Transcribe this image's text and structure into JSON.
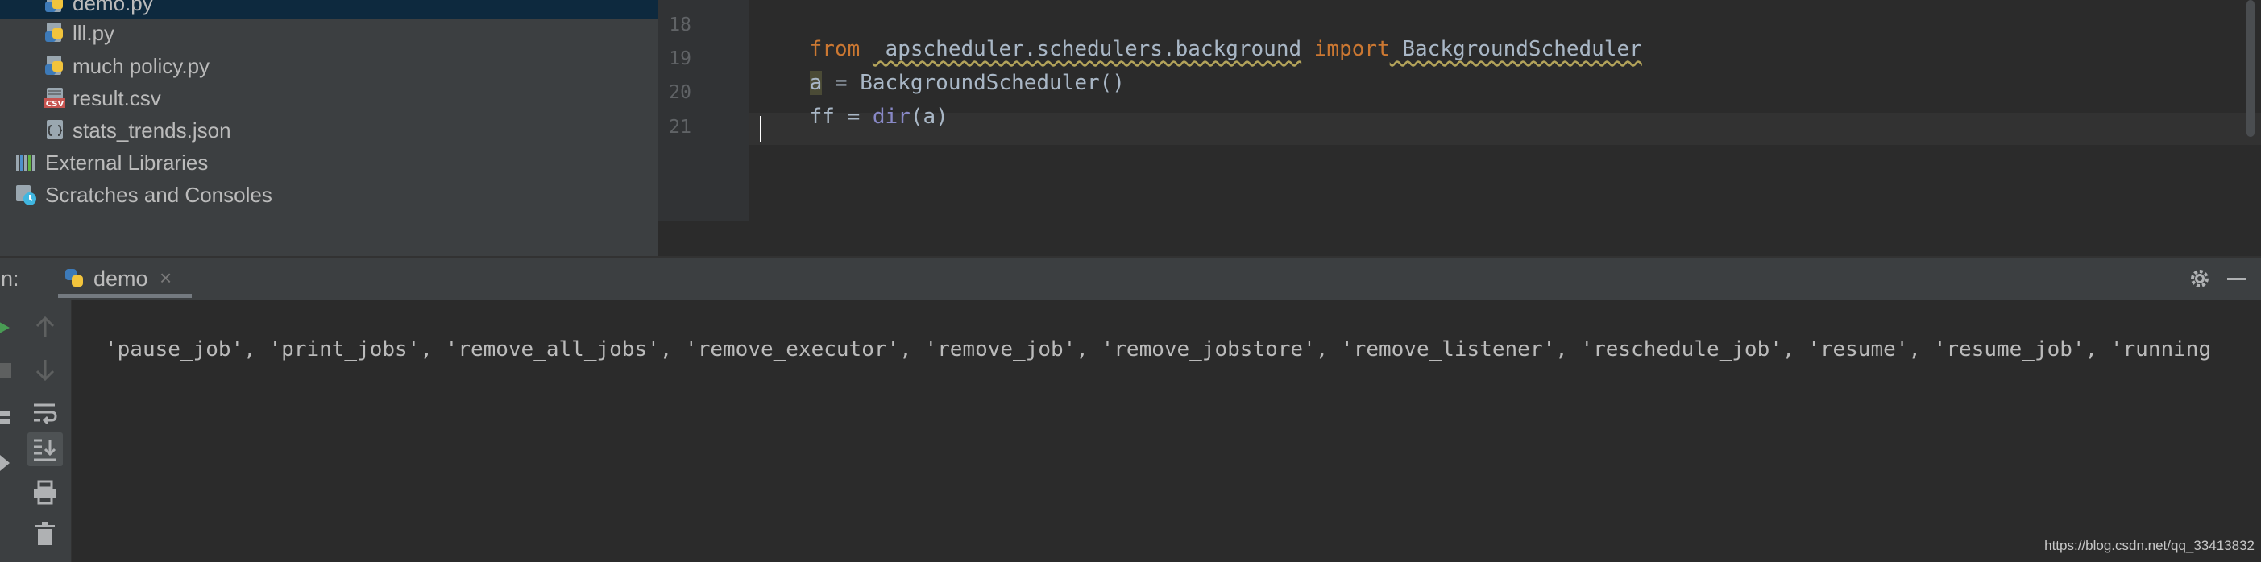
{
  "project_tree": {
    "items": [
      {
        "label": "demo.py",
        "icon": "python-file-icon",
        "selected": true
      },
      {
        "label": "lll.py",
        "icon": "python-file-icon"
      },
      {
        "label": "much policy.py",
        "icon": "python-file-icon"
      },
      {
        "label": "result.csv",
        "icon": "csv-file-icon"
      },
      {
        "label": "stats_trends.json",
        "icon": "json-file-icon"
      },
      {
        "label": "External Libraries",
        "icon": "libraries-icon"
      },
      {
        "label": "Scratches and Consoles",
        "icon": "scratches-icon"
      }
    ]
  },
  "editor": {
    "line_numbers": [
      "18",
      "19",
      "20",
      "21"
    ],
    "lines": [
      {
        "parts": [
          {
            "text": "from",
            "style": "keyword"
          },
          {
            "text": " ",
            "style": "plain"
          },
          {
            "text": " apscheduler.schedulers.background",
            "style": "squiggle"
          },
          {
            "text": " ",
            "style": "plain"
          },
          {
            "text": "import",
            "style": "keyword"
          },
          {
            "text": " BackgroundScheduler",
            "style": "squiggle"
          }
        ]
      },
      {
        "parts": [
          {
            "text": "a",
            "style": "highlight"
          },
          {
            "text": " = BackgroundScheduler()",
            "style": "plain"
          }
        ]
      },
      {
        "parts": [
          {
            "text": "ff = ",
            "style": "plain"
          },
          {
            "text": "dir",
            "style": "builtin"
          },
          {
            "text": "(a)",
            "style": "plain"
          }
        ]
      },
      {
        "parts": []
      }
    ],
    "current_line": "21"
  },
  "run_window": {
    "title": "un:",
    "tab_label": "demo",
    "tab_close": "×",
    "console_output": "'pause_job', 'print_jobs', 'remove_all_jobs', 'remove_executor', 'remove_job', 'remove_jobstore', 'remove_listener', 'reschedule_job', 'resume', 'resume_job', 'running"
  },
  "watermark": "https://blog.csdn.net/qq_33413832",
  "colors": {
    "keyword": "#cc7832",
    "builtin": "#8888c6",
    "text": "#a9b7c6",
    "background": "#2b2b2b",
    "panel": "#3c3f41",
    "selection": "#0d293e"
  }
}
